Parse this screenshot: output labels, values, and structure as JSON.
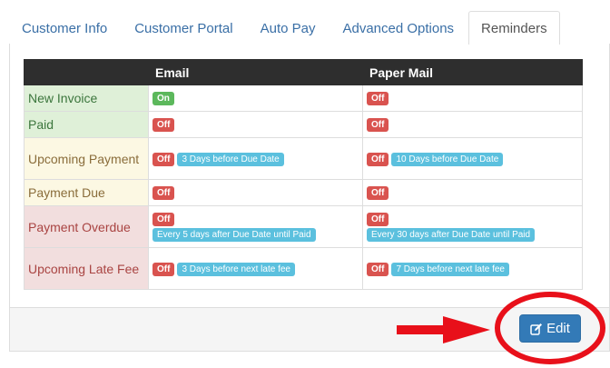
{
  "tabs": [
    {
      "label": "Customer Info",
      "active": false
    },
    {
      "label": "Customer Portal",
      "active": false
    },
    {
      "label": "Auto Pay",
      "active": false
    },
    {
      "label": "Advanced Options",
      "active": false
    },
    {
      "label": "Reminders",
      "active": true
    }
  ],
  "table": {
    "headers": {
      "email": "Email",
      "paper_mail": "Paper Mail"
    },
    "rows": [
      {
        "label": "New Invoice",
        "state": "success",
        "email": {
          "status": "On"
        },
        "paper": {
          "status": "Off"
        }
      },
      {
        "label": "Paid",
        "state": "success",
        "email": {
          "status": "Off"
        },
        "paper": {
          "status": "Off"
        }
      },
      {
        "label": "Upcoming Payment",
        "state": "warning",
        "email": {
          "status": "Off",
          "detail": "3 Days before Due Date"
        },
        "paper": {
          "status": "Off",
          "detail": "10 Days before Due Date"
        }
      },
      {
        "label": "Payment Due",
        "state": "warning",
        "email": {
          "status": "Off"
        },
        "paper": {
          "status": "Off"
        }
      },
      {
        "label": "Payment Overdue",
        "state": "danger",
        "email": {
          "status": "Off",
          "detail": "Every 5 days after Due Date until Paid"
        },
        "paper": {
          "status": "Off",
          "detail": "Every 30 days after Due Date until Paid"
        }
      },
      {
        "label": "Upcoming Late Fee",
        "state": "danger",
        "email": {
          "status": "Off",
          "detail": "3 Days before next late fee"
        },
        "paper": {
          "status": "Off",
          "detail": "7 Days before next late fee"
        }
      }
    ]
  },
  "edit_button": {
    "label": "Edit",
    "icon": "edit-icon"
  },
  "annotations": {
    "arrow_color": "#e8101a",
    "circle_color": "#e8101a"
  },
  "colors": {
    "tab_link": "#3a6fa6",
    "header_bg": "#2e2e2e",
    "success_bg": "#dff0d8",
    "warning_bg": "#fcf8e3",
    "danger_bg": "#f2dede",
    "badge_on": "#5cb85c",
    "badge_off": "#d9534f",
    "badge_info": "#5bc0de",
    "primary": "#337ab7"
  }
}
